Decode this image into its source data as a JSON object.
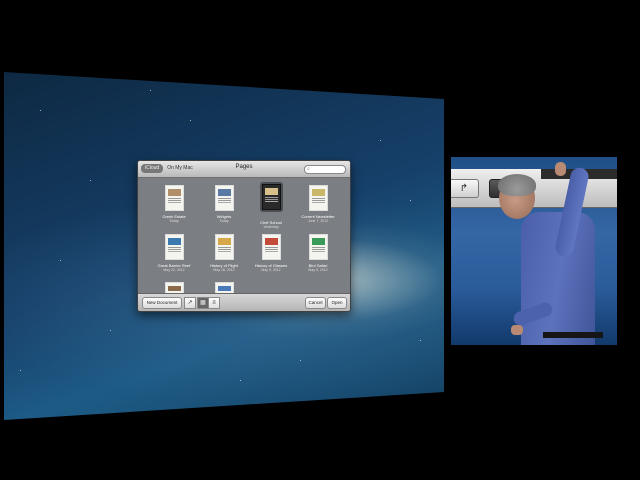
{
  "window": {
    "title": "Pages",
    "location_tabs": [
      "iCloud",
      "On My Mac"
    ],
    "search_placeholder": "",
    "documents": [
      {
        "name": "Greek Estate",
        "date": "Today"
      },
      {
        "name": "Widgets",
        "date": "Today"
      },
      {
        "name": "Chef School",
        "date": "Yesterday"
      },
      {
        "name": "Current Newsletter",
        "date": "June 7, 2012"
      },
      {
        "name": "Great Barrier Reef",
        "date": "May 22, 2012"
      },
      {
        "name": "History of Flight",
        "date": "May 18, 2012"
      },
      {
        "name": "History of Glasses",
        "date": "May 9, 2012"
      },
      {
        "name": "Bird Safari",
        "date": "May 5, 2012"
      },
      {
        "name": "",
        "date": ""
      },
      {
        "name": "",
        "date": ""
      }
    ],
    "new_document_label": "New Document",
    "cancel_label": "Cancel",
    "open_label": "Open"
  },
  "colors": {
    "window_bg": "#7b7e83",
    "desktop_blue": "#1d5b86",
    "video_bg": "#2a5b9a"
  }
}
